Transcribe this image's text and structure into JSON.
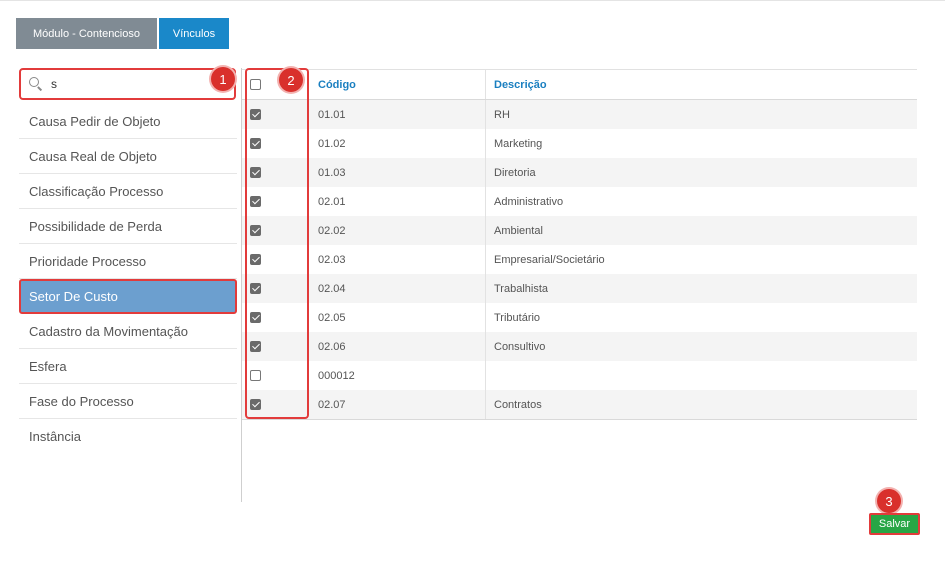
{
  "tabs": [
    {
      "label": "Módulo - Contencioso",
      "color": "#808b94"
    },
    {
      "label": "Vínculos",
      "color": "#1a88c9"
    }
  ],
  "search": {
    "value": "s",
    "placeholder": ""
  },
  "badges": [
    "1",
    "2",
    "3"
  ],
  "categories": [
    {
      "label": "Causa Pedir de Objeto",
      "active": false
    },
    {
      "label": "Causa Real de Objeto",
      "active": false
    },
    {
      "label": "Classificação Processo",
      "active": false
    },
    {
      "label": "Possibilidade de Perda",
      "active": false
    },
    {
      "label": "Prioridade Processo",
      "active": false
    },
    {
      "label": "Setor De Custo",
      "active": true
    },
    {
      "label": "Cadastro da Movimentação",
      "active": false
    },
    {
      "label": "Esfera",
      "active": false
    },
    {
      "label": "Fase do Processo",
      "active": false
    },
    {
      "label": "Instância",
      "active": false
    }
  ],
  "table": {
    "header": {
      "codigo": "Código",
      "descricao": "Descrição",
      "all_checked": false
    },
    "rows": [
      {
        "codigo": "01.01",
        "descricao": "RH",
        "checked": true
      },
      {
        "codigo": "01.02",
        "descricao": "Marketing",
        "checked": true
      },
      {
        "codigo": "01.03",
        "descricao": "Diretoria",
        "checked": true
      },
      {
        "codigo": "02.01",
        "descricao": "Administrativo",
        "checked": true
      },
      {
        "codigo": "02.02",
        "descricao": "Ambiental",
        "checked": true
      },
      {
        "codigo": "02.03",
        "descricao": "Empresarial/Societário",
        "checked": true
      },
      {
        "codigo": "02.04",
        "descricao": "Trabalhista",
        "checked": true
      },
      {
        "codigo": "02.05",
        "descricao": "Tributário",
        "checked": true
      },
      {
        "codigo": "02.06",
        "descricao": "Consultivo",
        "checked": true
      },
      {
        "codigo": "000012",
        "descricao": "",
        "checked": false
      },
      {
        "codigo": "02.07",
        "descricao": "Contratos",
        "checked": true
      }
    ]
  },
  "save_button": {
    "label": "Salvar",
    "color": "#27a645"
  },
  "highlight_color": "#e23b3b",
  "icons": {
    "search": "search-icon"
  }
}
